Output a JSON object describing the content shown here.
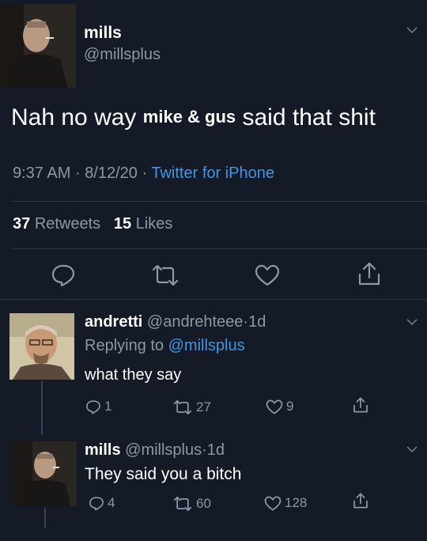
{
  "main_tweet": {
    "display_name": "mills",
    "handle": "@millsplus",
    "text_before": "Nah no way",
    "text_overlay": "mike & gus",
    "text_after": "said that shit",
    "time": "9:37 AM",
    "date": "8/12/20",
    "sep": "·",
    "source": "Twitter for iPhone",
    "retweets_count": "37",
    "retweets_label": "Retweets",
    "likes_count": "15",
    "likes_label": "Likes"
  },
  "replies": [
    {
      "display_name": "andretti",
      "handle": "@andrehteee",
      "sep": "·",
      "age": "1d",
      "replying_prefix": "Replying to",
      "replying_to": "@millsplus",
      "text": "what they say",
      "reply_count": "1",
      "retweet_count": "27",
      "like_count": "9"
    },
    {
      "display_name": "mills",
      "handle": "@millsplus",
      "sep": "·",
      "age": "1d",
      "text": "They said you a bitch",
      "reply_count": "4",
      "retweet_count": "60",
      "like_count": "128"
    }
  ],
  "colors": {
    "background": "#141b27",
    "muted": "#8b98a5",
    "link": "#3f97e6",
    "divider": "#2b3440"
  },
  "icons": [
    "chevron-down-icon",
    "reply-icon",
    "retweet-icon",
    "like-icon",
    "share-icon"
  ]
}
